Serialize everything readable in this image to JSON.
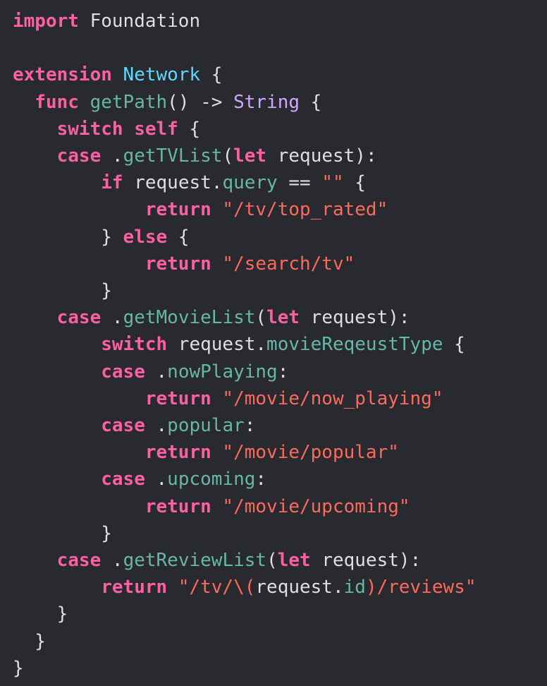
{
  "editor": {
    "language": "Swift",
    "colors": {
      "background": "#292a30",
      "plain": "#dfdfe0",
      "keyword": "#fc5fa3",
      "type_declaration": "#5dd8ff",
      "other_method": "#67b7a4",
      "other_type": "#d0a8ff",
      "string": "#fc6a5d"
    },
    "lines": [
      [
        {
          "t": "import",
          "k": "keyword"
        },
        {
          "t": " Foundation",
          "k": "plain"
        }
      ],
      [],
      [
        {
          "t": "extension",
          "k": "keyword"
        },
        {
          "t": " ",
          "k": "plain"
        },
        {
          "t": "Network",
          "k": "type_declaration"
        },
        {
          "t": " {",
          "k": "plain"
        }
      ],
      [
        {
          "t": "  ",
          "k": "plain"
        },
        {
          "t": "func",
          "k": "keyword"
        },
        {
          "t": " ",
          "k": "plain"
        },
        {
          "t": "getPath",
          "k": "other_method"
        },
        {
          "t": "() -> ",
          "k": "plain"
        },
        {
          "t": "String",
          "k": "other_type"
        },
        {
          "t": " {",
          "k": "plain"
        }
      ],
      [
        {
          "t": "    ",
          "k": "plain"
        },
        {
          "t": "switch",
          "k": "keyword"
        },
        {
          "t": " ",
          "k": "plain"
        },
        {
          "t": "self",
          "k": "keyword"
        },
        {
          "t": " {",
          "k": "plain"
        }
      ],
      [
        {
          "t": "    ",
          "k": "plain"
        },
        {
          "t": "case",
          "k": "keyword"
        },
        {
          "t": " .",
          "k": "plain"
        },
        {
          "t": "getTVList",
          "k": "other_method"
        },
        {
          "t": "(",
          "k": "plain"
        },
        {
          "t": "let",
          "k": "keyword"
        },
        {
          "t": " request):",
          "k": "plain"
        }
      ],
      [
        {
          "t": "        ",
          "k": "plain"
        },
        {
          "t": "if",
          "k": "keyword"
        },
        {
          "t": " request.",
          "k": "plain"
        },
        {
          "t": "query",
          "k": "other_method"
        },
        {
          "t": " == ",
          "k": "plain"
        },
        {
          "t": "\"\"",
          "k": "string"
        },
        {
          "t": " {",
          "k": "plain"
        }
      ],
      [
        {
          "t": "            ",
          "k": "plain"
        },
        {
          "t": "return",
          "k": "keyword"
        },
        {
          "t": " ",
          "k": "plain"
        },
        {
          "t": "\"/tv/top_rated\"",
          "k": "string"
        }
      ],
      [
        {
          "t": "        } ",
          "k": "plain"
        },
        {
          "t": "else",
          "k": "keyword"
        },
        {
          "t": " {",
          "k": "plain"
        }
      ],
      [
        {
          "t": "            ",
          "k": "plain"
        },
        {
          "t": "return",
          "k": "keyword"
        },
        {
          "t": " ",
          "k": "plain"
        },
        {
          "t": "\"/search/tv\"",
          "k": "string"
        }
      ],
      [
        {
          "t": "        }",
          "k": "plain"
        }
      ],
      [
        {
          "t": "    ",
          "k": "plain"
        },
        {
          "t": "case",
          "k": "keyword"
        },
        {
          "t": " .",
          "k": "plain"
        },
        {
          "t": "getMovieList",
          "k": "other_method"
        },
        {
          "t": "(",
          "k": "plain"
        },
        {
          "t": "let",
          "k": "keyword"
        },
        {
          "t": " request):",
          "k": "plain"
        }
      ],
      [
        {
          "t": "        ",
          "k": "plain"
        },
        {
          "t": "switch",
          "k": "keyword"
        },
        {
          "t": " request.",
          "k": "plain"
        },
        {
          "t": "movieReqeustType",
          "k": "other_method"
        },
        {
          "t": " {",
          "k": "plain"
        }
      ],
      [
        {
          "t": "        ",
          "k": "plain"
        },
        {
          "t": "case",
          "k": "keyword"
        },
        {
          "t": " .",
          "k": "plain"
        },
        {
          "t": "nowPlaying",
          "k": "other_method"
        },
        {
          "t": ":",
          "k": "plain"
        }
      ],
      [
        {
          "t": "            ",
          "k": "plain"
        },
        {
          "t": "return",
          "k": "keyword"
        },
        {
          "t": " ",
          "k": "plain"
        },
        {
          "t": "\"/movie/now_playing\"",
          "k": "string"
        }
      ],
      [
        {
          "t": "        ",
          "k": "plain"
        },
        {
          "t": "case",
          "k": "keyword"
        },
        {
          "t": " .",
          "k": "plain"
        },
        {
          "t": "popular",
          "k": "other_method"
        },
        {
          "t": ":",
          "k": "plain"
        }
      ],
      [
        {
          "t": "            ",
          "k": "plain"
        },
        {
          "t": "return",
          "k": "keyword"
        },
        {
          "t": " ",
          "k": "plain"
        },
        {
          "t": "\"/movie/popular\"",
          "k": "string"
        }
      ],
      [
        {
          "t": "        ",
          "k": "plain"
        },
        {
          "t": "case",
          "k": "keyword"
        },
        {
          "t": " .",
          "k": "plain"
        },
        {
          "t": "upcoming",
          "k": "other_method"
        },
        {
          "t": ":",
          "k": "plain"
        }
      ],
      [
        {
          "t": "            ",
          "k": "plain"
        },
        {
          "t": "return",
          "k": "keyword"
        },
        {
          "t": " ",
          "k": "plain"
        },
        {
          "t": "\"/movie/upcoming\"",
          "k": "string"
        }
      ],
      [
        {
          "t": "        }",
          "k": "plain"
        }
      ],
      [
        {
          "t": "    ",
          "k": "plain"
        },
        {
          "t": "case",
          "k": "keyword"
        },
        {
          "t": " .",
          "k": "plain"
        },
        {
          "t": "getReviewList",
          "k": "other_method"
        },
        {
          "t": "(",
          "k": "plain"
        },
        {
          "t": "let",
          "k": "keyword"
        },
        {
          "t": " request):",
          "k": "plain"
        }
      ],
      [
        {
          "t": "        ",
          "k": "plain"
        },
        {
          "t": "return",
          "k": "keyword"
        },
        {
          "t": " ",
          "k": "plain"
        },
        {
          "t": "\"/tv/\\(",
          "k": "string"
        },
        {
          "t": "request.",
          "k": "plain"
        },
        {
          "t": "id",
          "k": "other_method"
        },
        {
          "t": ")/reviews\"",
          "k": "string"
        }
      ],
      [
        {
          "t": "    }",
          "k": "plain"
        }
      ],
      [
        {
          "t": "  }",
          "k": "plain"
        }
      ],
      [
        {
          "t": "}",
          "k": "plain"
        }
      ]
    ]
  }
}
